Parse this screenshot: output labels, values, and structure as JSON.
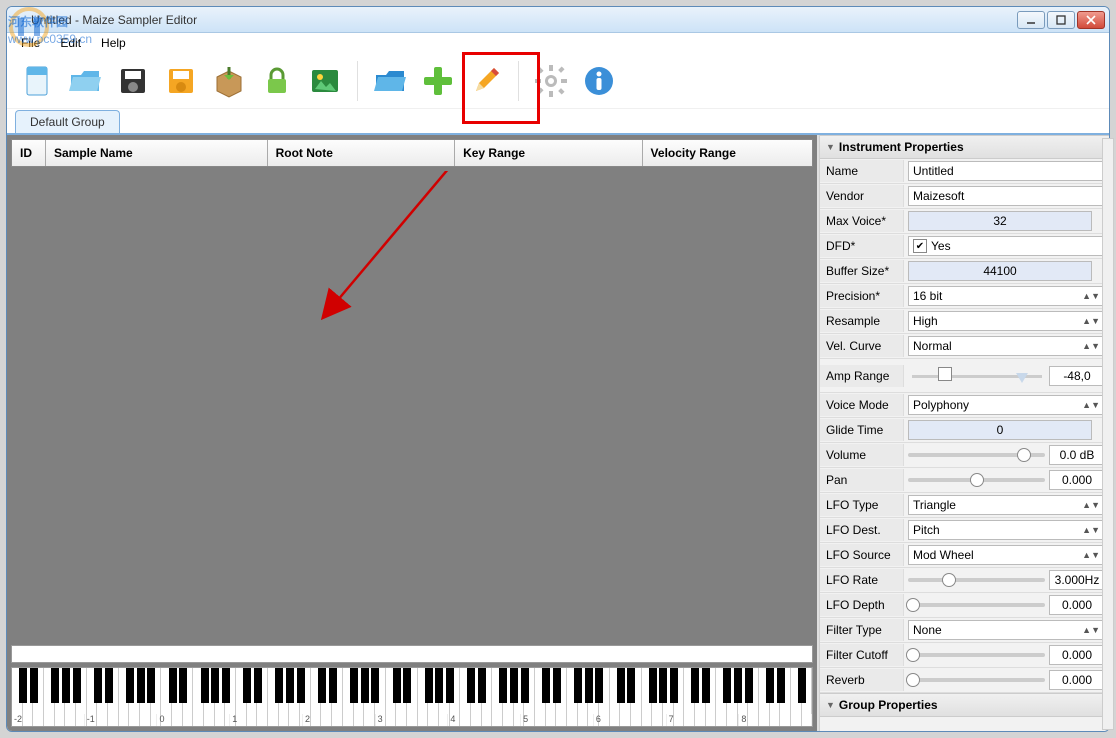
{
  "titlebar": {
    "title": "Untitled - Maize Sampler Editor"
  },
  "watermark": {
    "text": "河东软件园",
    "url": "www.pc0359.cn"
  },
  "menu": {
    "file": "File",
    "edit": "Edit",
    "help": "Help"
  },
  "toolbar": {
    "icons": [
      "new-file",
      "open-folder",
      "save-disk",
      "save-as",
      "import-box",
      "lock",
      "picture",
      "folder-blue",
      "plus",
      "pencil",
      "gear",
      "info"
    ]
  },
  "tabs": {
    "default": "Default Group"
  },
  "table": {
    "headers": {
      "id": "ID",
      "sample": "Sample Name",
      "root": "Root Note",
      "keyrange": "Key Range",
      "velrange": "Velocity Range"
    }
  },
  "keyboard": {
    "labels": [
      "-2",
      "-1",
      "0",
      "1",
      "2",
      "3",
      "4",
      "5",
      "6",
      "7",
      "8"
    ]
  },
  "panel": {
    "section1": "Instrument Properties",
    "section2": "Group Properties",
    "name_l": "Name",
    "name_v": "Untitled",
    "vendor_l": "Vendor",
    "vendor_v": "Maizesoft",
    "maxvoice_l": "Max Voice*",
    "maxvoice_v": "32",
    "dfd_l": "DFD*",
    "dfd_v": "Yes",
    "buffer_l": "Buffer Size*",
    "buffer_v": "44100",
    "precision_l": "Precision*",
    "precision_v": "16 bit",
    "resample_l": "Resample",
    "resample_v": "High",
    "velcurve_l": "Vel. Curve",
    "velcurve_v": "Normal",
    "amprange_l": "Amp Range",
    "amprange_v": "-48,0",
    "voicemode_l": "Voice Mode",
    "voicemode_v": "Polyphony",
    "glide_l": "Glide Time",
    "glide_v": "0",
    "volume_l": "Volume",
    "volume_v": "0.0 dB",
    "pan_l": "Pan",
    "pan_v": "0.000",
    "lfotype_l": "LFO Type",
    "lfotype_v": "Triangle",
    "lfodest_l": "LFO Dest.",
    "lfodest_v": "Pitch",
    "lfosrc_l": "LFO Source",
    "lfosrc_v": "Mod Wheel",
    "lforate_l": "LFO Rate",
    "lforate_v": "3.000Hz",
    "lfodepth_l": "LFO Depth",
    "lfodepth_v": "0.000",
    "filtertype_l": "Filter Type",
    "filtertype_v": "None",
    "filtercut_l": "Filter Cutoff",
    "filtercut_v": "0.000",
    "reverb_l": "Reverb",
    "reverb_v": "0.000"
  }
}
